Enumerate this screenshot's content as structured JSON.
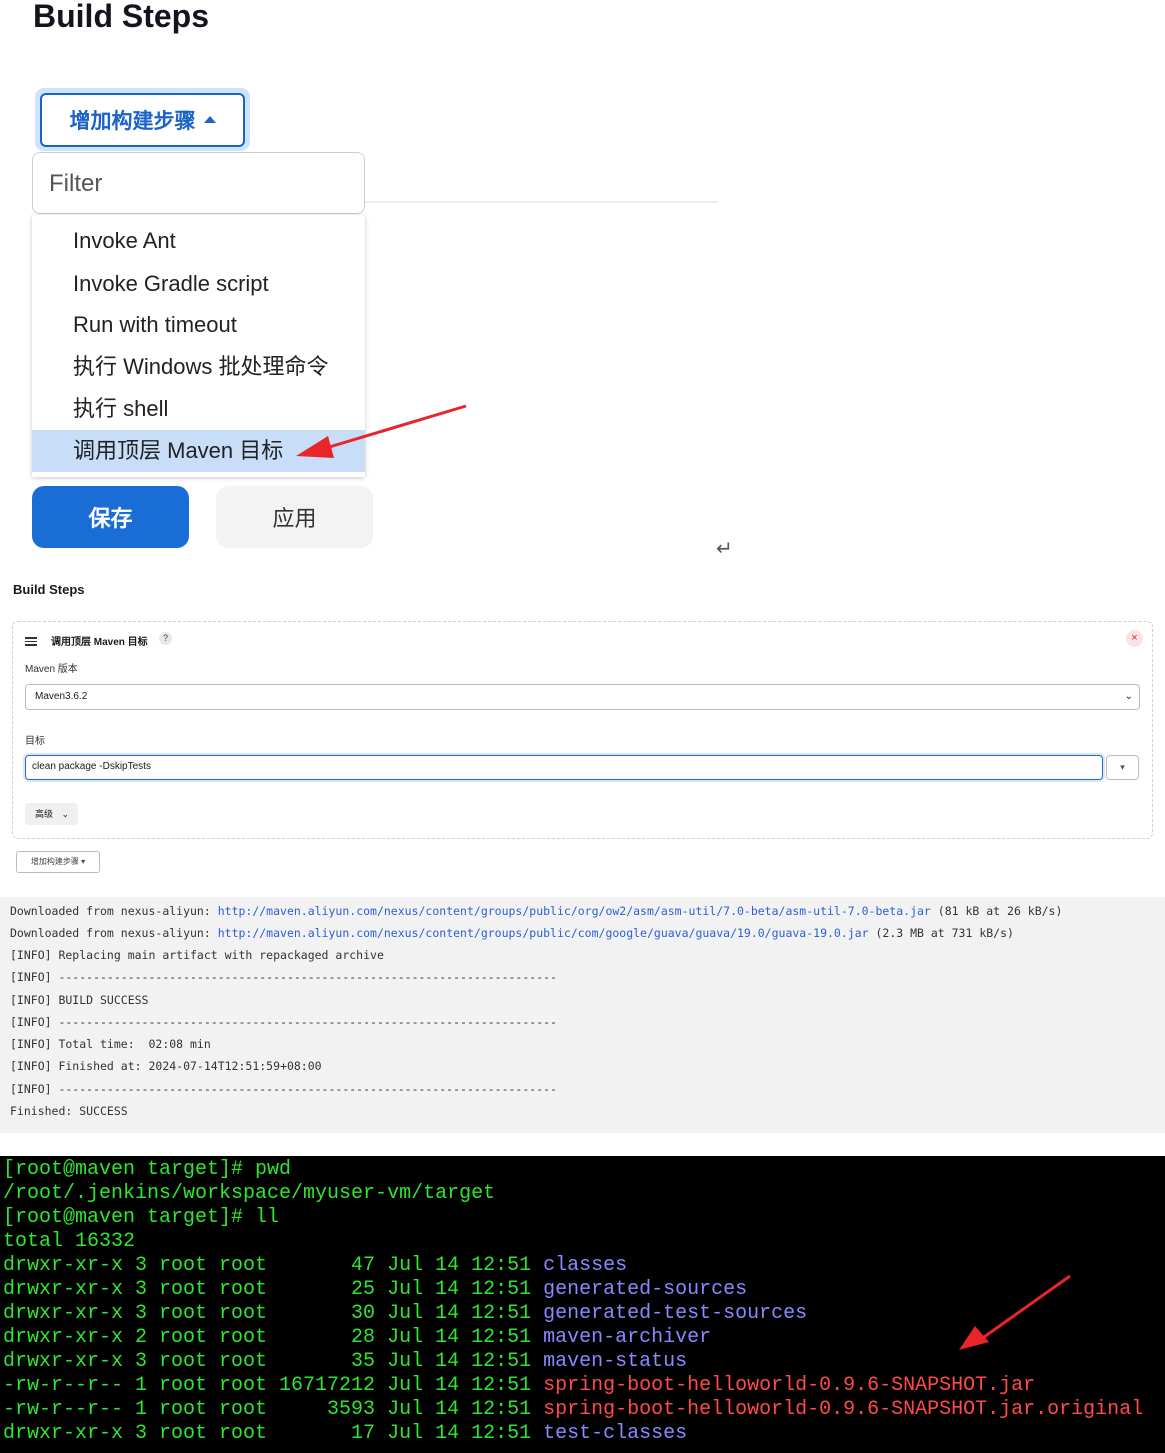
{
  "section1": {
    "heading": "Build Steps",
    "add_step_button": "增加构建步骤",
    "filter_placeholder": "Filter",
    "menu_items": [
      "Invoke Ant",
      "Invoke Gradle script",
      "Run with timeout",
      "执行 Windows 批处理命令",
      "执行 shell",
      "调用顶层 Maven 目标"
    ],
    "selected_item": "调用顶层 Maven 目标",
    "save_button": "保存",
    "apply_button": "应用",
    "return_glyph": "↵"
  },
  "section2": {
    "heading": "Build Steps",
    "step_title": "调用顶层 Maven 目标",
    "help_label": "?",
    "close_label": "×",
    "maven_version_label": "Maven 版本",
    "maven_version_value": "Maven3.6.2",
    "goal_label": "目标",
    "goal_value": "clean package -DskipTests",
    "goal_expand": "▾",
    "advanced_button": "高级",
    "add_step_button": "增加构建步骤"
  },
  "console": {
    "lines": [
      {
        "prefix": "Downloaded from nexus-aliyun: ",
        "link": "http://maven.aliyun.com/nexus/content/groups/public/org/ow2/asm/asm-util/7.0-beta/asm-util-7.0-beta.jar",
        "suffix": " (81 kB at 26 kB/s)"
      },
      {
        "prefix": "Downloaded from nexus-aliyun: ",
        "link": "http://maven.aliyun.com/nexus/content/groups/public/com/google/guava/guava/19.0/guava-19.0.jar",
        "suffix": " (2.3 MB at 731 kB/s)"
      },
      {
        "text": "[INFO] Replacing main artifact with repackaged archive"
      },
      {
        "text": "[INFO] ------------------------------------------------------------------------"
      },
      {
        "text": "[INFO] BUILD SUCCESS"
      },
      {
        "text": "[INFO] ------------------------------------------------------------------------"
      },
      {
        "text": "[INFO] Total time:  02:08 min"
      },
      {
        "text": "[INFO] Finished at: 2024-07-14T12:51:59+08:00"
      },
      {
        "text": "[INFO] ------------------------------------------------------------------------"
      },
      {
        "text": "Finished: SUCCESS"
      }
    ]
  },
  "terminal": {
    "lines": [
      {
        "text": "[root@maven target]# pwd"
      },
      {
        "text": "/root/.jenkins/workspace/myuser-vm/target"
      },
      {
        "text": "[root@maven target]# ll"
      },
      {
        "text": "total 16332"
      },
      {
        "perm": "drwxr-xr-x 3 root root       47 Jul 14 12:51 ",
        "name": "classes",
        "kind": "dir"
      },
      {
        "perm": "drwxr-xr-x 3 root root       25 Jul 14 12:51 ",
        "name": "generated-sources",
        "kind": "dir"
      },
      {
        "perm": "drwxr-xr-x 3 root root       30 Jul 14 12:51 ",
        "name": "generated-test-sources",
        "kind": "dir"
      },
      {
        "perm": "drwxr-xr-x 2 root root       28 Jul 14 12:51 ",
        "name": "maven-archiver",
        "kind": "dir"
      },
      {
        "perm": "drwxr-xr-x 3 root root       35 Jul 14 12:51 ",
        "name": "maven-status",
        "kind": "dir"
      },
      {
        "perm": "-rw-r--r-- 1 root root 16717212 Jul 14 12:51 ",
        "name": "spring-boot-helloworld-0.9.6-SNAPSHOT.jar",
        "kind": "jar"
      },
      {
        "perm": "-rw-r--r-- 1 root root     3593 Jul 14 12:51 ",
        "name": "spring-boot-helloworld-0.9.6-SNAPSHOT.jar.original",
        "kind": "jar"
      },
      {
        "perm": "drwxr-xr-x 3 root root       17 Jul 14 12:51 ",
        "name": "test-classes",
        "kind": "dir"
      }
    ]
  },
  "annotation_color": "#e8262a"
}
